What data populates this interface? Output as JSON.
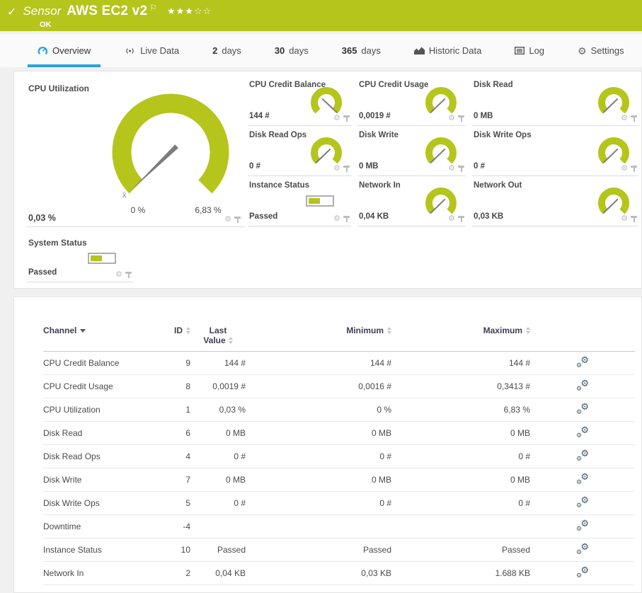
{
  "header": {
    "kind_label": "Sensor",
    "title": "AWS EC2 v2",
    "status": "OK",
    "stars_filled": 3,
    "stars_total": 5
  },
  "tabs": {
    "overview": {
      "label": "Overview"
    },
    "live_data": {
      "label": "Live Data"
    },
    "days_2": {
      "num": "2",
      "label": "days"
    },
    "days_30": {
      "num": "30",
      "label": "days"
    },
    "days_365": {
      "num": "365",
      "label": "days"
    },
    "historic_data": {
      "label": "Historic Data"
    },
    "log": {
      "label": "Log"
    },
    "settings": {
      "label": "Settings"
    }
  },
  "gauges": {
    "main": {
      "title": "CPU Utilization",
      "value": "0,03 %",
      "min_label": "0 %",
      "max_label": "6,83 %",
      "avg_marker": "x̄"
    },
    "mini": [
      {
        "title": "CPU Credit Balance",
        "value": "144 #",
        "type": "gauge",
        "needle": "max"
      },
      {
        "title": "CPU Credit Usage",
        "value": "0,0019 #",
        "type": "gauge",
        "needle": "min"
      },
      {
        "title": "Disk Read",
        "value": "0 MB",
        "type": "gauge",
        "needle": "min"
      },
      {
        "title": "Disk Read Ops",
        "value": "0 #",
        "type": "gauge",
        "needle": "min"
      },
      {
        "title": "Disk Write",
        "value": "0 MB",
        "type": "gauge",
        "needle": "min"
      },
      {
        "title": "Disk Write Ops",
        "value": "0 #",
        "type": "gauge",
        "needle": "min"
      },
      {
        "title": "Instance Status",
        "value": "Passed",
        "type": "status"
      },
      {
        "title": "Network In",
        "value": "0,04 KB",
        "type": "gauge",
        "needle": "min"
      },
      {
        "title": "Network Out",
        "value": "0,03 KB",
        "type": "gauge",
        "needle": "min"
      }
    ],
    "system_status": {
      "title": "System Status",
      "value": "Passed"
    }
  },
  "table": {
    "columns": {
      "channel": "Channel",
      "id": "ID",
      "last_line1": "Last",
      "last_line2": "Value",
      "minimum": "Minimum",
      "maximum": "Maximum"
    },
    "rows": [
      {
        "channel": "CPU Credit Balance",
        "id": "9",
        "last": "144 #",
        "min": "144 #",
        "max": "144 #"
      },
      {
        "channel": "CPU Credit Usage",
        "id": "8",
        "last": "0,0019 #",
        "min": "0,0016 #",
        "max": "0,3413 #"
      },
      {
        "channel": "CPU Utilization",
        "id": "1",
        "last": "0,03 %",
        "min": "0 %",
        "max": "6,83 %"
      },
      {
        "channel": "Disk Read",
        "id": "6",
        "last": "0 MB",
        "min": "0 MB",
        "max": "0 MB"
      },
      {
        "channel": "Disk Read Ops",
        "id": "4",
        "last": "0 #",
        "min": "0 #",
        "max": "0 #"
      },
      {
        "channel": "Disk Write",
        "id": "7",
        "last": "0 MB",
        "min": "0 MB",
        "max": "0 MB"
      },
      {
        "channel": "Disk Write Ops",
        "id": "5",
        "last": "0 #",
        "min": "0 #",
        "max": "0 #"
      },
      {
        "channel": "Downtime",
        "id": "-4",
        "last": "",
        "min": "",
        "max": ""
      },
      {
        "channel": "Instance Status",
        "id": "10",
        "last": "Passed",
        "min": "Passed",
        "max": "Passed"
      },
      {
        "channel": "Network In",
        "id": "2",
        "last": "0,04 KB",
        "min": "0,03 KB",
        "max": "1.688 KB"
      }
    ]
  },
  "colors": {
    "status_green": "#b5c51c",
    "tab_active_blue": "#29a3d8",
    "needle_gray": "#7c7c7c",
    "icon_gray": "#bcbcbc",
    "gears_slate": "#41586a"
  }
}
